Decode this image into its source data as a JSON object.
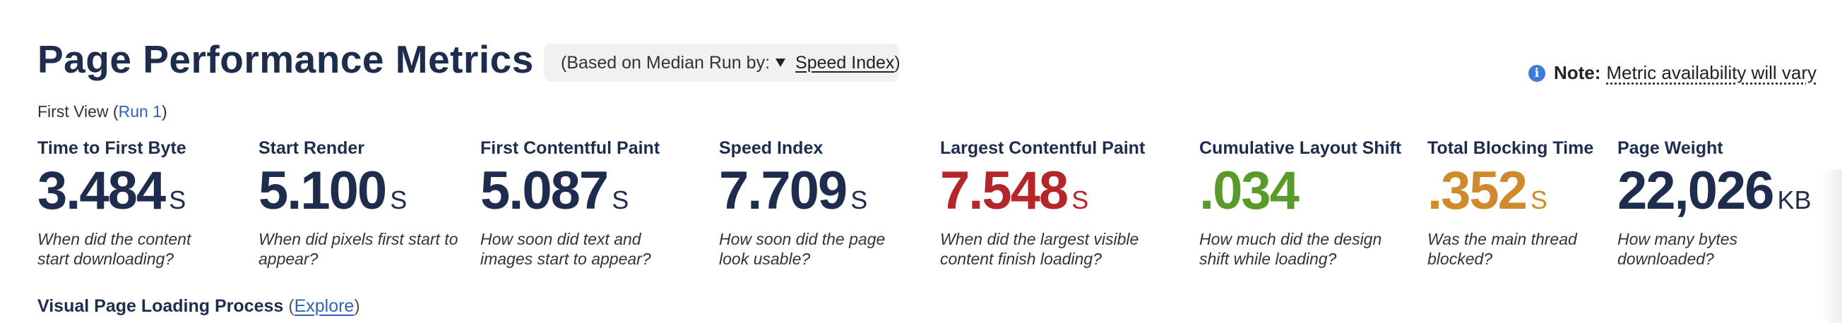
{
  "header": {
    "title": "Page Performance Metrics",
    "basis_prefix": "(Based on Median Run by:",
    "basis_selected": "Speed Index",
    "basis_suffix": ")",
    "note_label": "Note:",
    "note_text": "Metric availability will vary",
    "info_icon": "info-circle-icon"
  },
  "view": {
    "label": "First View (",
    "run_link": "Run 1",
    "suffix": ")"
  },
  "metrics": [
    {
      "label": "Time to First Byte",
      "value": "3.484",
      "unit": "S",
      "desc": "When did the content start downloading?",
      "color": "#1e2c4e"
    },
    {
      "label": "Start Render",
      "value": "5.100",
      "unit": "S",
      "desc": "When did pixels first start to appear?",
      "color": "#1e2c4e"
    },
    {
      "label": "First Contentful Paint",
      "value": "5.087",
      "unit": "S",
      "desc": "How soon did text and images start to appear?",
      "color": "#1e2c4e"
    },
    {
      "label": "Speed Index",
      "value": "7.709",
      "unit": "S",
      "desc": "How soon did the page look usable?",
      "color": "#1e2c4e"
    },
    {
      "label": "Largest Contentful Paint",
      "value": "7.548",
      "unit": "S",
      "desc": "When did the largest visible content finish loading?",
      "color": "#b5262b"
    },
    {
      "label": "Cumulative Layout Shift",
      "value": ".034",
      "unit": "",
      "desc": "How much did the design shift while loading?",
      "color": "#5a9a2a"
    },
    {
      "label": "Total Blocking Time",
      "value": ".352",
      "unit": "S",
      "desc": "Was the main thread blocked?",
      "color": "#d08a2c"
    },
    {
      "label": "Page Weight",
      "value": "22,026",
      "unit": "KB",
      "desc": "How many bytes downloaded?",
      "color": "#1e2c4e"
    }
  ],
  "visual": {
    "label": "Visual Page Loading Process",
    "open": "(",
    "link": "Explore",
    "close": ")"
  }
}
